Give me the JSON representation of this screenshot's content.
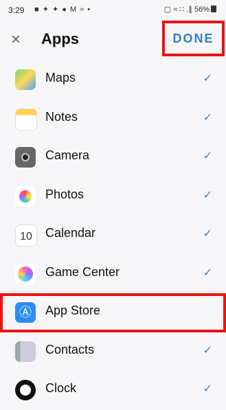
{
  "status": {
    "time": "3:29",
    "icons": "■ ✦ ✦ ● M ≈ •",
    "right": "▢ ≈ ∷ .∥ 56%"
  },
  "header": {
    "close_icon": "×",
    "title": "Apps",
    "done_label": "DONE"
  },
  "apps": [
    {
      "label": "Maps",
      "icon": "maps-icon",
      "checked": true
    },
    {
      "label": "Notes",
      "icon": "notes-icon",
      "checked": true
    },
    {
      "label": "Camera",
      "icon": "camera-icon",
      "checked": true
    },
    {
      "label": "Photos",
      "icon": "photos-icon",
      "checked": true
    },
    {
      "label": "Calendar",
      "icon": "calendar-icon",
      "checked": true,
      "icon_text": "10"
    },
    {
      "label": "Game Center",
      "icon": "game-center-icon",
      "checked": true
    },
    {
      "label": "App Store",
      "icon": "app-store-icon",
      "checked": false,
      "icon_text": "Ⓐ"
    },
    {
      "label": "Contacts",
      "icon": "contacts-icon",
      "checked": true
    },
    {
      "label": "Clock",
      "icon": "clock-icon",
      "checked": true
    }
  ],
  "check_glyph": "✓",
  "colors": {
    "accent": "#2f7fc7",
    "highlight": "#e11111",
    "check": "#3b82c4"
  }
}
